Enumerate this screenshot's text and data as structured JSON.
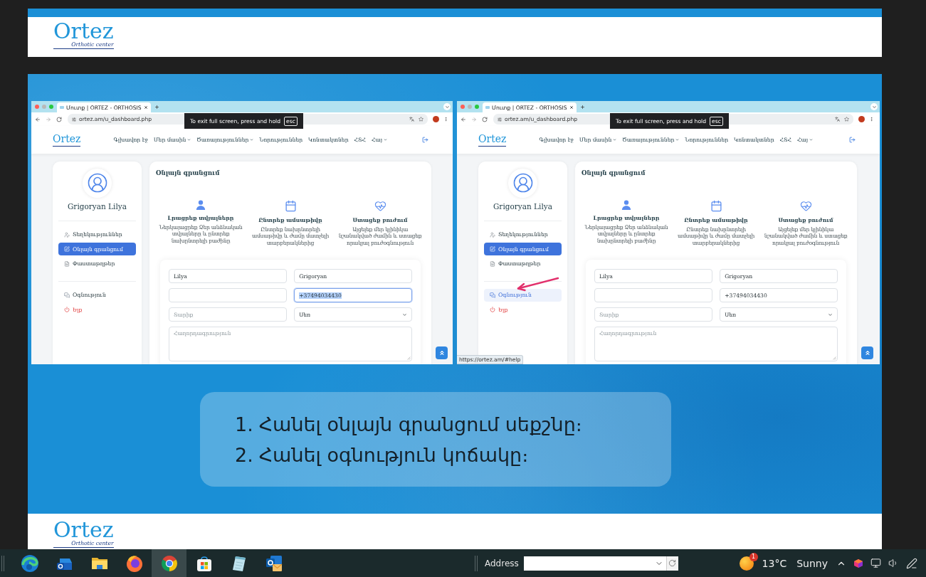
{
  "previous_slide": {
    "logo": {
      "title": "Ortez",
      "tagline": "Orthotic center"
    }
  },
  "slide": {
    "screenshots": [
      {
        "tab_title": "Մուտք | ORTEZ - ORTHOSIS",
        "address": "ortez.am/u_dashboard.php",
        "fullscreen_notice": {
          "text": "To exit full screen, press and hold",
          "key": "esc"
        },
        "site": {
          "logo": "Ortez",
          "nav": [
            {
              "label": "Գլխավոր էջ",
              "dropdown": false
            },
            {
              "label": "Մեր մասին",
              "dropdown": true
            },
            {
              "label": "Ծառայություններ",
              "dropdown": true
            },
            {
              "label": "Նորություններ",
              "dropdown": false
            },
            {
              "label": "Կոնտակտներ",
              "dropdown": false
            },
            {
              "label": "ՀՏՀ",
              "dropdown": false
            },
            {
              "label": "Հայ",
              "dropdown": true
            }
          ],
          "sidebar": {
            "user_name": "Grigoryan Lilya",
            "menu_sections": [
              {
                "items": [
                  {
                    "kind": "info",
                    "label": "Տեղեկություններ",
                    "selected": false,
                    "hovered": false
                  },
                  {
                    "kind": "booking",
                    "label": "Օնլայն գրանցում",
                    "selected": true,
                    "hovered": false
                  },
                  {
                    "kind": "documents",
                    "label": "Փաստաթղթեր",
                    "selected": false,
                    "hovered": false
                  }
                ]
              },
              {
                "items": [
                  {
                    "kind": "help",
                    "label": "Օգնություն",
                    "selected": false,
                    "hovered": false
                  },
                  {
                    "kind": "logout",
                    "label": "Ելք",
                    "selected": false,
                    "hovered": false
                  }
                ]
              }
            ]
          },
          "page_title": "Օնլայն գրանցում",
          "steps": [
            {
              "kind": "person",
              "title": "Լրացրեք տվյալները",
              "text": "Ներկայացրեք Ձեր անձնական տվյալները և ընտրեք նախընտրելի բաժինը"
            },
            {
              "kind": "calendar",
              "title": "Ընտրեք ամսաթիվը",
              "text": "Ընտրեք նախընտրելի ամսաթիվը և ժամը մատչելի տարբերակներից"
            },
            {
              "kind": "heartbeat",
              "title": "Ստացեք բուժում",
              "text": "Այցելեք մեր կլինիկա նշանակված ժամին և ստացեք որակյալ բուժօգնություն"
            }
          ],
          "form": {
            "fields": [
              {
                "kind": "input",
                "value": "Lilya",
                "focused": false
              },
              {
                "kind": "input",
                "value": "Grigoryan",
                "focused": false
              },
              {
                "kind": "input",
                "focused": false
              },
              {
                "kind": "input",
                "value": "+37494034430",
                "focused": true
              },
              {
                "kind": "input",
                "placeholder": "Տարիք",
                "focused": false
              },
              {
                "kind": "select",
                "value": "Սեռ",
                "focused": false
              },
              {
                "kind": "textarea",
                "placeholder": "Հաղորդագրություն",
                "focused": false
              }
            ]
          }
        }
      },
      {
        "tab_title": "Մուտք | ORTEZ - ORTHOSIS",
        "address": "ortez.am/u_dashboard.php",
        "fullscreen_notice": {
          "text": "To exit full screen, press and hold",
          "key": "esc"
        },
        "site": {
          "logo": "Ortez",
          "nav": [
            {
              "label": "Գլխավոր էջ",
              "dropdown": false
            },
            {
              "label": "Մեր մասին",
              "dropdown": true
            },
            {
              "label": "Ծառայություններ",
              "dropdown": true
            },
            {
              "label": "Նորություններ",
              "dropdown": false
            },
            {
              "label": "Կոնտակտներ",
              "dropdown": false
            },
            {
              "label": "ՀՏՀ",
              "dropdown": false
            },
            {
              "label": "Հայ",
              "dropdown": true
            }
          ],
          "sidebar": {
            "user_name": "Grigoryan Lilya",
            "menu_sections": [
              {
                "items": [
                  {
                    "kind": "info",
                    "label": "Տեղեկություններ",
                    "selected": false,
                    "hovered": false
                  },
                  {
                    "kind": "booking",
                    "label": "Օնլայն գրանցում",
                    "selected": true,
                    "hovered": false
                  },
                  {
                    "kind": "documents",
                    "label": "Փաստաթղթեր",
                    "selected": false,
                    "hovered": false
                  }
                ]
              },
              {
                "items": [
                  {
                    "kind": "help",
                    "label": "Օգնություն",
                    "selected": false,
                    "hovered": true
                  },
                  {
                    "kind": "logout",
                    "label": "Ելք",
                    "selected": false,
                    "hovered": false
                  }
                ]
              }
            ]
          },
          "page_title": "Օնլայն գրանցում",
          "steps": [
            {
              "kind": "person",
              "title": "Լրացրեք տվյալները",
              "text": "Ներկայացրեք Ձեր անձնական տվյալները և ընտրեք նախընտրելի բաժինը"
            },
            {
              "kind": "calendar",
              "title": "Ընտրեք ամսաթիվը",
              "text": "Ընտրեք նախընտրելի ամսաթիվը և ժամը մատչելի տարբերակներից"
            },
            {
              "kind": "heartbeat",
              "title": "Ստացեք բուժում",
              "text": "Այցելեք մեր կլինիկա նշանակված ժամին և ստացեք որակյալ բուժօգնություն"
            }
          ],
          "form": {
            "fields": [
              {
                "kind": "input",
                "value": "Lilya",
                "focused": false
              },
              {
                "kind": "input",
                "value": "Grigoryan",
                "focused": false
              },
              {
                "kind": "input",
                "focused": false
              },
              {
                "kind": "input",
                "value": "+37494034430",
                "focused": false
              },
              {
                "kind": "input",
                "placeholder": "Տարիք",
                "focused": false
              },
              {
                "kind": "select",
                "value": "Սեռ",
                "focused": false
              },
              {
                "kind": "textarea",
                "placeholder": "Հաղորդագրություն",
                "focused": false
              }
            ]
          }
        },
        "pointer_arrow": true,
        "status_link": "https://ortez.am/#help"
      }
    ],
    "instructions": [
      {
        "number": "1.",
        "text": "Հանել օնլայն գրանցում սեքշնը։"
      },
      {
        "number": "2.",
        "text": "Հանել օգնություն կոճակը։"
      }
    ],
    "footer_logo": {
      "title": "Ortez",
      "tagline": "Orthotic center"
    }
  },
  "taskbar": {
    "apps": [
      {
        "kind": "swirl",
        "selected": false
      },
      {
        "kind": "mailbox",
        "selected": false
      },
      {
        "kind": "folder",
        "selected": false
      },
      {
        "kind": "fox",
        "selected": false
      },
      {
        "kind": "wheel",
        "selected": true
      },
      {
        "kind": "bag",
        "selected": false
      },
      {
        "kind": "notepad",
        "selected": false
      },
      {
        "kind": "mail",
        "selected": false
      }
    ],
    "address_bar": {
      "label": "Address"
    },
    "weather": {
      "badge": "1",
      "temperature": "13°C",
      "condition": "Sunny"
    }
  }
}
